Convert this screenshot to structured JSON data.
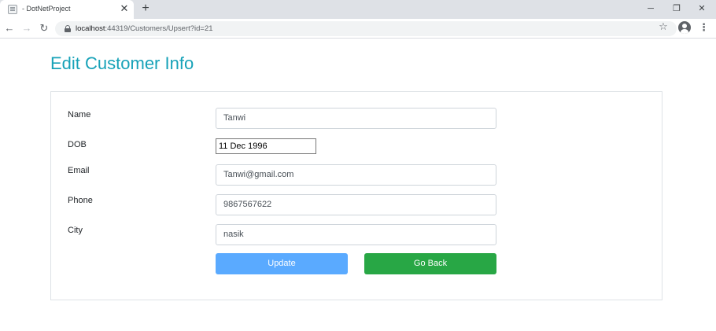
{
  "browser": {
    "tab_title": "- DotNetProject",
    "tab_close": "✕",
    "new_tab": "+",
    "url_host": "localhost",
    "url_path": ":44319/Customers/Upsert?id=21",
    "window_controls": {
      "minimize": "─",
      "restore": "❐",
      "close": "✕"
    },
    "icons": [
      "back-arrow-icon",
      "forward-arrow-icon",
      "reload-icon",
      "lock-icon",
      "star-icon",
      "profile-icon",
      "menu-icon"
    ]
  },
  "page": {
    "title": "Edit Customer Info"
  },
  "form": {
    "name": {
      "label": "Name",
      "value": "Tanwi"
    },
    "dob": {
      "label": "DOB",
      "value": "11 Dec 1996"
    },
    "email": {
      "label": "Email",
      "value": "Tanwi@gmail.com"
    },
    "phone": {
      "label": "Phone",
      "value": "9867567622"
    },
    "city": {
      "label": "City",
      "value": "nasik"
    },
    "update_label": "Update",
    "back_label": "Go Back"
  },
  "colors": {
    "title": "#17a2b8",
    "update_button": "#5aaaff",
    "back_button": "#28a745"
  }
}
